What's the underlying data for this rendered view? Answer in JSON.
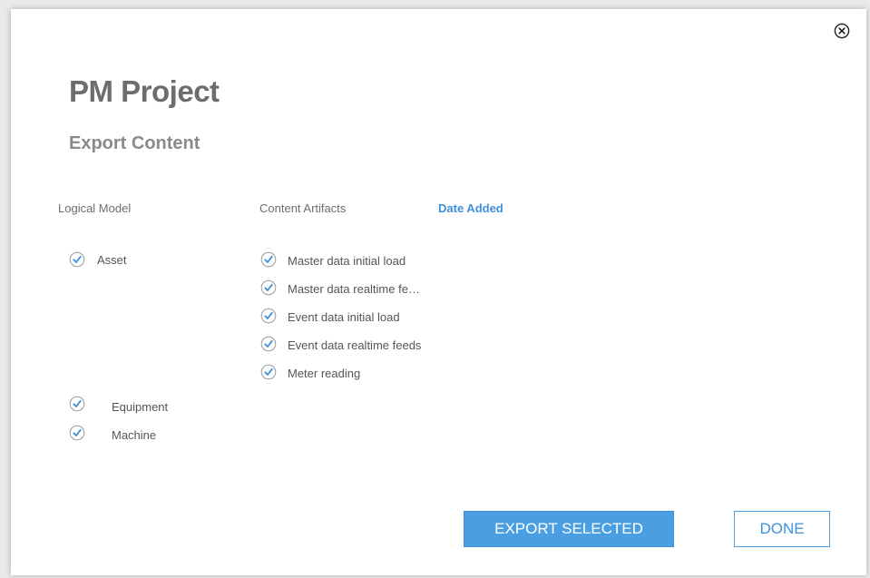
{
  "dialog": {
    "title": "PM Project",
    "subtitle": "Export Content"
  },
  "columns": {
    "logical_model": "Logical Model",
    "content_artifacts": "Content Artifacts",
    "date_added": "Date Added"
  },
  "logical_model_items": [
    {
      "label": "Asset",
      "checked": true
    },
    {
      "label": "Equipment",
      "checked": true
    },
    {
      "label": "Machine",
      "checked": true
    }
  ],
  "content_artifacts_items": [
    {
      "label": "Master data initial load",
      "checked": true
    },
    {
      "label": "Master data realtime fe…",
      "checked": true
    },
    {
      "label": "Event data initial load",
      "checked": true
    },
    {
      "label": "Event data realtime feeds",
      "checked": true
    },
    {
      "label": "Meter reading",
      "checked": true
    }
  ],
  "buttons": {
    "export_selected": "EXPORT SELECTED",
    "done": "DONE"
  },
  "icons": {
    "close": "close-circle-icon",
    "check": "check-circle-icon"
  },
  "colors": {
    "accent": "#4a9fe3",
    "link": "#3d8fdc",
    "title": "#6d6d6d"
  }
}
